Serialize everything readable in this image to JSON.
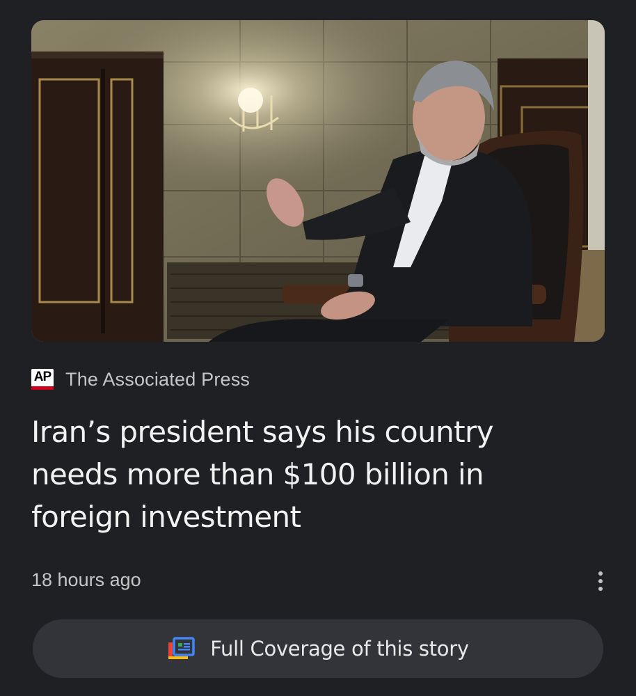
{
  "article": {
    "image_alt": "Iran's president seated in a carved wooden chair gesturing during an interview",
    "source": {
      "logo_text": "AP",
      "name": "The Associated Press"
    },
    "headline": "Iran’s president says his country needs more than $100 billion in foreign investment",
    "timestamp": "18 hours ago",
    "more_icon": "more-vert-icon"
  },
  "full_coverage": {
    "icon": "full-coverage-icon",
    "label": "Full Coverage of this story"
  },
  "colors": {
    "background": "#1f2024",
    "button_background": "#33343a",
    "ap_red": "#d0021b"
  }
}
